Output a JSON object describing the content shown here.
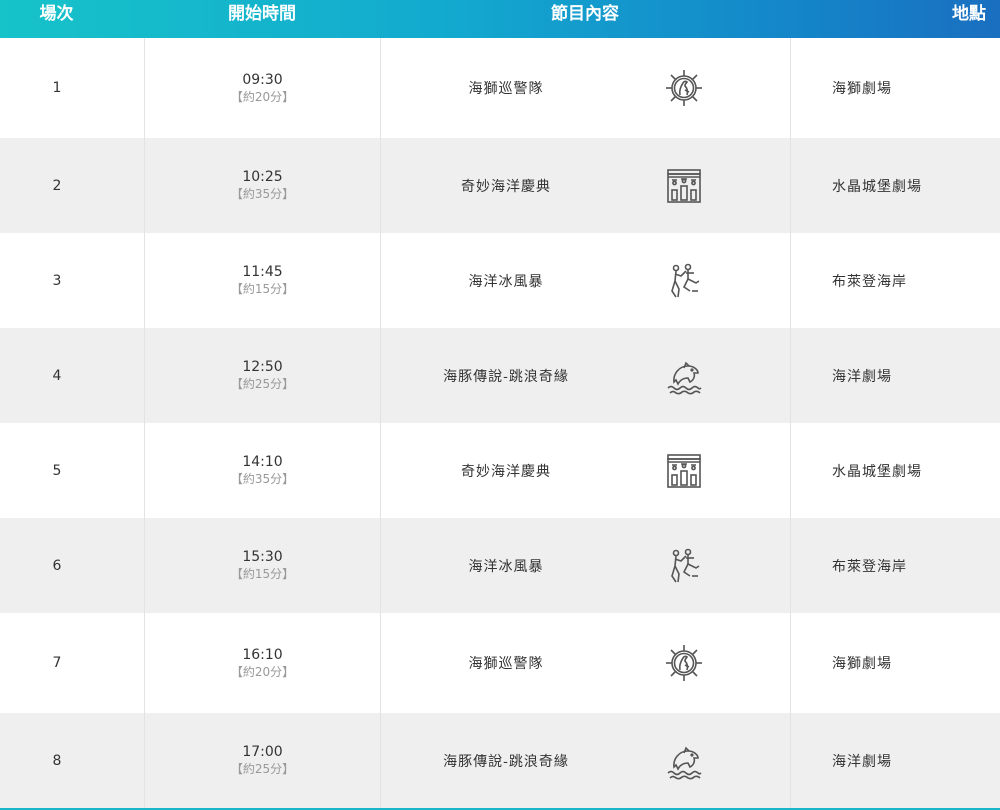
{
  "header": {
    "index": "場次",
    "start_time": "開始時間",
    "program": "節目內容",
    "location": "地點"
  },
  "rows": [
    {
      "index": "1",
      "time": "09:30",
      "duration": "【約20分】",
      "program": "海獅巡警隊",
      "icon": "sea-lion-wheel-icon",
      "location": "海獅劇場"
    },
    {
      "index": "2",
      "time": "10:25",
      "duration": "【約35分】",
      "program": "奇妙海洋慶典",
      "icon": "crystal-castle-stage-icon",
      "location": "水晶城堡劇場"
    },
    {
      "index": "3",
      "time": "11:45",
      "duration": "【約15分】",
      "program": "海洋冰風暴",
      "icon": "ice-dancers-icon",
      "location": "布萊登海岸"
    },
    {
      "index": "4",
      "time": "12:50",
      "duration": "【約25分】",
      "program": "海豚傳說-跳浪奇緣",
      "icon": "dolphin-icon",
      "location": "海洋劇場"
    },
    {
      "index": "5",
      "time": "14:10",
      "duration": "【約35分】",
      "program": "奇妙海洋慶典",
      "icon": "crystal-castle-stage-icon",
      "location": "水晶城堡劇場"
    },
    {
      "index": "6",
      "time": "15:30",
      "duration": "【約15分】",
      "program": "海洋冰風暴",
      "icon": "ice-dancers-icon",
      "location": "布萊登海岸"
    },
    {
      "index": "7",
      "time": "16:10",
      "duration": "【約20分】",
      "program": "海獅巡警隊",
      "icon": "sea-lion-wheel-icon",
      "location": "海獅劇場"
    },
    {
      "index": "8",
      "time": "17:00",
      "duration": "【約25分】",
      "program": "海豚傳說-跳浪奇緣",
      "icon": "dolphin-icon",
      "location": "海洋劇場"
    }
  ],
  "colors": {
    "header_gradient_start": "#16c3c9",
    "header_gradient_end": "#1a6fc0",
    "row_alt": "#efefef",
    "icon_stroke": "#555555"
  }
}
